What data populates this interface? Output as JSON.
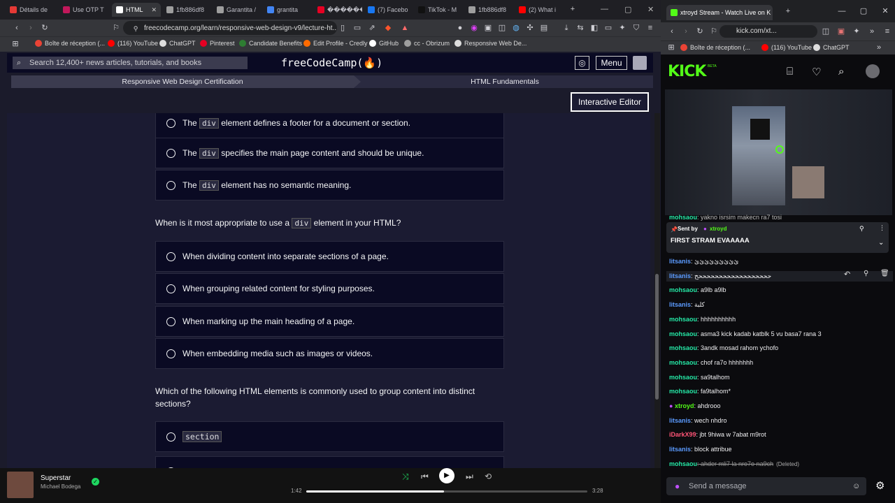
{
  "left_browser": {
    "tabs": [
      {
        "label": "Détails de",
        "color": "#e53935"
      },
      {
        "label": "Use OTP T",
        "color": "#c2185b"
      },
      {
        "label": "HTML",
        "color": "#ffffff",
        "active": true
      },
      {
        "label": "1fb886df8",
        "color": "#9e9e9e"
      },
      {
        "label": "Garantita /",
        "color": "#9e9e9e"
      },
      {
        "label": "grantita",
        "color": "#4285f4"
      },
      {
        "label": "�������",
        "color": "#e60023"
      },
      {
        "label": "(7) Facebo",
        "color": "#1877f2"
      },
      {
        "label": "TikTok - M",
        "color": "#111111"
      },
      {
        "label": "1fb886df8",
        "color": "#9e9e9e"
      },
      {
        "label": "(2) What i",
        "color": "#ff0000"
      }
    ],
    "url": "freecodecamp.org/learn/responsive-web-design-v9/lecture-ht...",
    "bookmarks": [
      {
        "label": "Boîte de réception (...",
        "color": "#ea4335"
      },
      {
        "label": "(116) YouTube",
        "color": "#ff0000"
      },
      {
        "label": "ChatGPT",
        "color": "#dddddd"
      },
      {
        "label": "Pinterest",
        "color": "#e60023"
      },
      {
        "label": "Candidate Benefits",
        "color": "#2e7d32"
      },
      {
        "label": "Edit Profile - Credly",
        "color": "#ff6b00"
      },
      {
        "label": "GitHub",
        "color": "#ffffff"
      },
      {
        "label": "cc - Obrizum",
        "color": "#9e9e9e"
      },
      {
        "label": "Responsive Web De...",
        "color": "#dddddd"
      }
    ]
  },
  "fcc": {
    "search_placeholder": "Search 12,400+ news articles, tutorials, and books",
    "brand": "freeCodeCamp(🔥)",
    "menu": "Menu",
    "breadcrumb_1": "Responsive Web Design Certification",
    "breadcrumb_2": "HTML Fundamentals",
    "interactive_editor": "Interactive Editor",
    "prev_options": [
      {
        "pre": "The ",
        "code": "div",
        "post": " element defines a footer for a document or section."
      },
      {
        "pre": "The ",
        "code": "div",
        "post": " specifies the main page content and should be unique."
      },
      {
        "pre": "The ",
        "code": "div",
        "post": " element has no semantic meaning."
      }
    ],
    "question_2": {
      "pre": "When is it most appropriate to use a ",
      "code": "div",
      "post": " element in your HTML?"
    },
    "q2_options": [
      "When dividing content into separate sections of a page.",
      "When grouping related content for styling purposes.",
      "When marking up the main heading of a page.",
      "When embedding media such as images or videos."
    ],
    "question_3": "Which of the following HTML elements is commonly used to group content into distinct sections?",
    "q3_options": [
      "section"
    ]
  },
  "player": {
    "song": "Superstar",
    "artist": "Michael Bodega",
    "elapsed": "1:42",
    "duration": "3:28",
    "progress": 0.49
  },
  "right_browser": {
    "tab_title": "xtroyd Stream - Watch Live on K",
    "url": "kick.com/xt...",
    "bookmarks": [
      "Boîte de réception (...",
      "(116) YouTube",
      "ChatGPT"
    ],
    "logo": "KICK",
    "logo_badge": "BETA",
    "partial_msg": {
      "user": "mohsaou",
      "text": ": yakno isrsim makecn ra7 tosi"
    },
    "pinned": {
      "sent_by": "Sent by",
      "user": "xtroyd",
      "message": "FIRST STRAM EVAAAAA"
    },
    "chat": [
      {
        "user": "litsanis",
        "text": ": ﺉﺉﺉﺉﺉﺉﺉﺉﺉ",
        "color": "#5b9bff"
      },
      {
        "user": "litsanis",
        "text": ": ححححححححححححححححححح",
        "color": "#5b9bff"
      },
      {
        "user": "mohsaou",
        "text": ": a9lb a9lb",
        "color": "#25e8a6"
      },
      {
        "user": "litsanis",
        "text": ": كلبة",
        "color": "#5b9bff"
      },
      {
        "user": "mohsaou",
        "text": ": hhhhhhhhhh",
        "color": "#25e8a6"
      },
      {
        "user": "mohsaou",
        "text": ": asma3 kick kadab katblk 5 vu basa7 rana 3",
        "color": "#25e8a6"
      },
      {
        "user": "mohsaou",
        "text": ": 3andk mosad rahom ychofo",
        "color": "#25e8a6"
      },
      {
        "user": "mohsaou",
        "text": ": chof ra7o hhhhhhh",
        "color": "#25e8a6"
      },
      {
        "user": "mohsaou",
        "text": ": sa9talhom",
        "color": "#25e8a6"
      },
      {
        "user": "mohsaou",
        "text": ": fa9talhom*",
        "color": "#25e8a6"
      },
      {
        "user": "xtroyd",
        "text": ": ahdrooo",
        "color": "#53fc18",
        "badge": true
      },
      {
        "user": "litsanis",
        "text": ": wech nhdro",
        "color": "#5b9bff"
      },
      {
        "user": "iDarkX99",
        "text": ": jbt 9hiwa w 7abat m9rot",
        "color": "#ff5577"
      },
      {
        "user": "litsanis",
        "text": ": block attribue",
        "color": "#5b9bff"
      },
      {
        "user": "mohsaou",
        "text": ": ahder mli7 la nro7o na9ch",
        "color": "#25e8a6",
        "deleted": "(Deleted)"
      }
    ],
    "send_placeholder": "Send a message"
  }
}
